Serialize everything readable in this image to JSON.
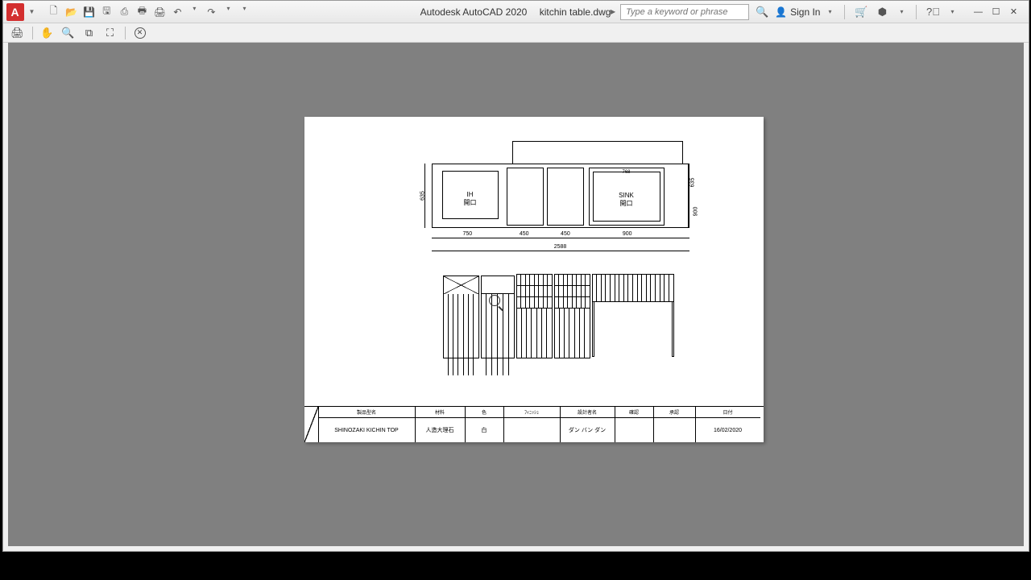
{
  "title": {
    "app": "Autodesk AutoCAD 2020",
    "file": "kitchin table.dwg"
  },
  "search": {
    "placeholder": "Type a keyword or phrase"
  },
  "signin": {
    "label": "Sign In"
  },
  "drawing": {
    "plan": {
      "ih_label1": "IH",
      "ih_label2": "開口",
      "sink_label1": "SINK",
      "sink_label2": "開口",
      "sink_dim_top": "768",
      "dim_left": "635",
      "dim_right1": "635",
      "dim_right2": "900",
      "dim_b1": "750",
      "dim_b2": "450",
      "dim_b3": "450",
      "dim_b4": "900",
      "dim_total": "2588"
    },
    "title_block": {
      "headers": {
        "c1": "製品型名",
        "c2": "材料",
        "c3": "色",
        "c4": "ﾌｨﾆｯｼｭ",
        "c5": "設計者名",
        "c6": "確認",
        "c7": "承認",
        "c8": "日付"
      },
      "values": {
        "c1": "SHINOZAKI KICHIN TOP",
        "c2": "人造大理石",
        "c3": "白",
        "c4": "",
        "c5": "ダン バン ダン",
        "c6": "",
        "c7": "",
        "c8": "16/02/2020"
      }
    }
  }
}
